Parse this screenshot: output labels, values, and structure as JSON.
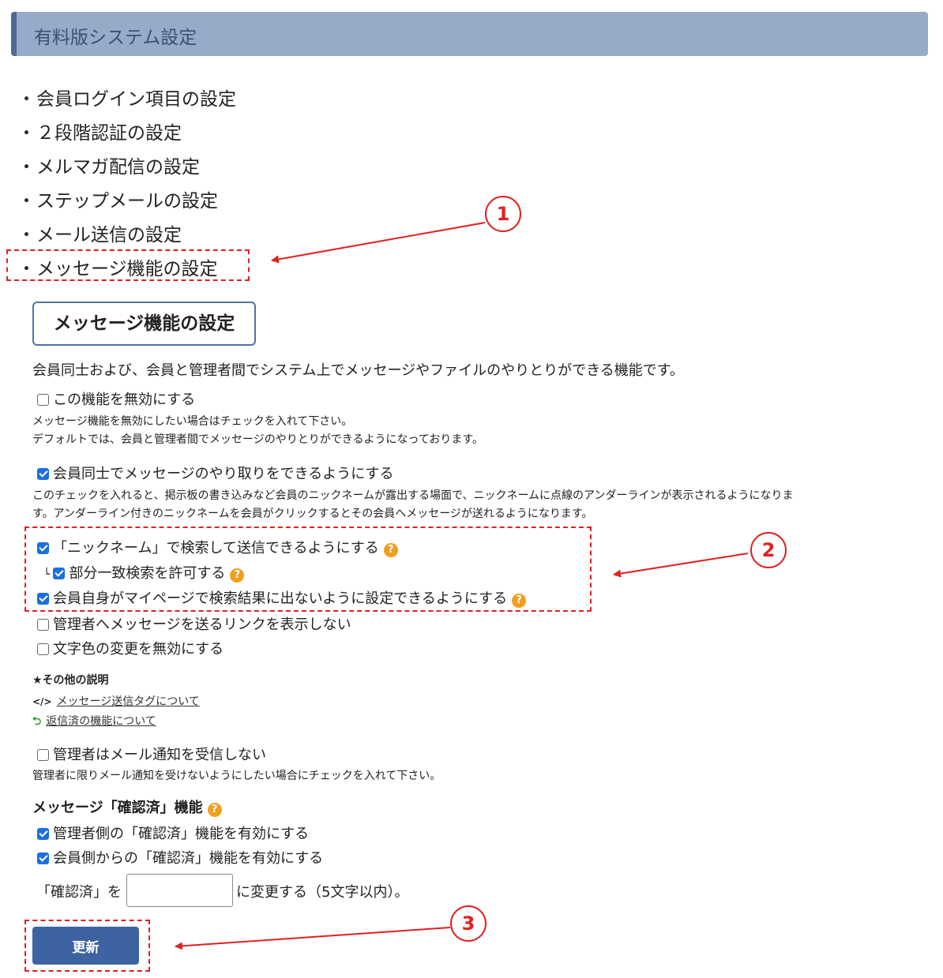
{
  "header": {
    "title": "有料版システム設定"
  },
  "menu": [
    "会員ログイン項目の設定",
    "２段階認証の設定",
    "メルマガ配信の設定",
    "ステップメールの設定",
    "メール送信の設定",
    "メッセージ機能の設定"
  ],
  "menu_bullet": "・",
  "section": {
    "title": "メッセージ機能の設定",
    "description": "会員同士および、会員と管理者間でシステム上でメッセージやファイルのやりとりができる機能です。"
  },
  "options": {
    "disable": {
      "label": "この機能を無効にする",
      "checked": false
    },
    "disable_note1": "メッセージ機能を無効にしたい場合はチェックを入れて下さい。",
    "disable_note2": "デフォルトでは、会員と管理者間でメッセージのやりとりができるようになっております。",
    "member_to_member": {
      "label": "会員同士でメッセージのやり取りをできるようにする",
      "checked": true
    },
    "mm_note1": "このチェックを入れると、掲示板の書き込みなど会員のニックネームが露出する場面で、ニックネームに点線のアンダーラインが表示されるようになりま",
    "mm_note2": "す。アンダーライン付きのニックネームを会員がクリックするとその会員へメッセージが送れるようになります。",
    "nickname_search": {
      "label": "「ニックネーム」で検索して送信できるようにする",
      "checked": true
    },
    "partial_match": {
      "prefix": "└",
      "label": "部分一致検索を許可する",
      "checked": true
    },
    "hide_self": {
      "label": "会員自身がマイページで検索結果に出ないように設定できるようにする",
      "checked": true
    },
    "hide_admin_link": {
      "label": "管理者へメッセージを送るリンクを表示しない",
      "checked": false
    },
    "disable_color": {
      "label": "文字色の変更を無効にする",
      "checked": false
    }
  },
  "other": {
    "heading": "★その他の説明",
    "link1_icon": "</>",
    "link1": "メッセージ送信タグについて",
    "link2_icon": "⮌",
    "link2": "返信済の機能について"
  },
  "admin_mail": {
    "label": "管理者はメール通知を受信しない",
    "checked": false,
    "note": "管理者に限りメール通知を受けないようにしたい場合にチェックを入れて下さい。"
  },
  "confirm": {
    "heading": "メッセージ「確認済」機能",
    "admin_side": {
      "label": "管理者側の「確認済」機能を有効にする",
      "checked": true
    },
    "member_side": {
      "label": "会員側からの「確認済」機能を有効にする",
      "checked": true
    },
    "rename_prefix": "「確認済」を",
    "rename_value": "",
    "rename_suffix": "に変更する（5文字以内）。"
  },
  "help_glyph": "?",
  "submit_label": "更新",
  "callouts": [
    "1",
    "2",
    "3"
  ],
  "colors": {
    "header_bg": "#97aac8",
    "accent": "#3e63a3",
    "annotation": "#e02020",
    "help": "#f0a020"
  }
}
